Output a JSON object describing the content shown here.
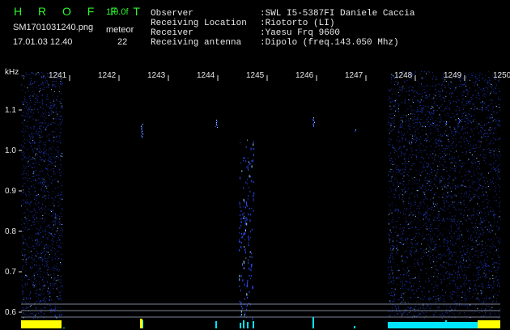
{
  "header": {
    "brand": "H R O F F T",
    "version": "1.0.0f",
    "filename": "SM1701031240.png",
    "mode": "meteor",
    "datetime": "17.01.03 12.40",
    "count": "22"
  },
  "info": [
    {
      "label": "Observer",
      "value": ":SWL I5-5387FI Daniele Caccia"
    },
    {
      "label": "Receiving Location",
      "value": ":Riotorto (LI)"
    },
    {
      "label": "Receiver",
      "value": ":Yaesu Frq 9600"
    },
    {
      "label": "Receiving antenna",
      "value": ":Dipolo (freq.143.050 Mhz)"
    }
  ],
  "axes": {
    "y_unit": "kHz",
    "y_ticks": [
      "1.1",
      "1.0",
      "0.9",
      "0.8",
      "0.7",
      "0.6"
    ],
    "x_ticks": [
      "1241",
      "1242",
      "1243",
      "1244",
      "1245",
      "1246",
      "1247",
      "1248",
      "1249",
      "1250"
    ]
  },
  "colors": {
    "noise": "#2a4cff",
    "highlight": "#9fd8ff",
    "marker_yellow": "#ffff00",
    "marker_cyan": "#00e5ff",
    "guide": "#9aa4b8"
  }
}
